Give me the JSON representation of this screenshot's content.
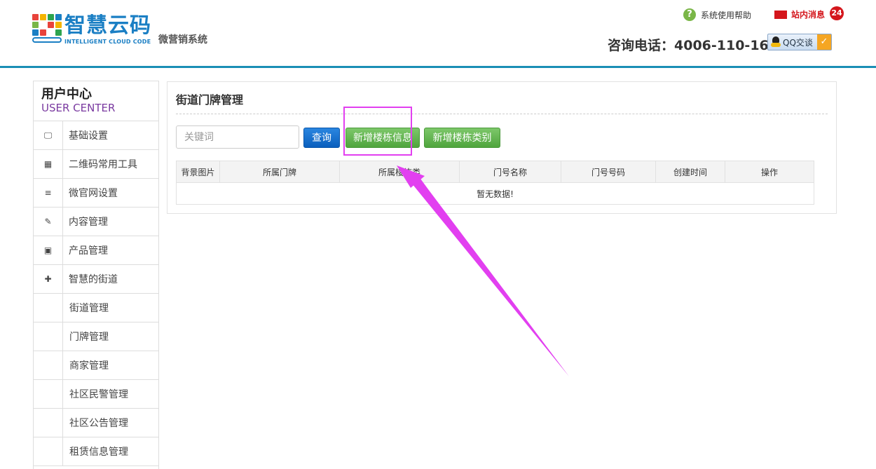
{
  "header": {
    "logo_cn": "智慧云码",
    "logo_en": "INTELLIGENT CLOUD CODE",
    "logo_sub": "微营销系统",
    "help_icon_char": "?",
    "help_label": "系统使用帮助",
    "messages_label": "站内消息",
    "messages_count": "24",
    "phone": "咨询电话：4006-110-166",
    "qq_label": "QQ交谈",
    "qq_check": "✓"
  },
  "sidebar": {
    "title_cn": "用户中心",
    "title_en": "USER CENTER",
    "items": [
      {
        "label": "基础设置",
        "icon": "monitor-icon",
        "glyph": "🖵"
      },
      {
        "label": "二维码常用工具",
        "icon": "qrcode-icon",
        "glyph": "▦"
      },
      {
        "label": "微官网设置",
        "icon": "list-icon",
        "glyph": "≡"
      },
      {
        "label": "内容管理",
        "icon": "edit-icon",
        "glyph": "✎"
      },
      {
        "label": "产品管理",
        "icon": "image-icon",
        "glyph": "▣"
      },
      {
        "label": "智慧的街道",
        "icon": "puzzle-icon",
        "glyph": "✚"
      }
    ],
    "sub_items": [
      "街道管理",
      "门牌管理",
      "商家管理",
      "社区民警管理",
      "社区公告管理",
      "租赁信息管理"
    ]
  },
  "main": {
    "title": "街道门牌管理",
    "search_placeholder": "关键词",
    "query_label": "查询",
    "add_building_info_label": "新增楼栋信息",
    "add_building_category_label": "新增楼栋类别",
    "columns": [
      "背景图片",
      "所属门牌",
      "所属楼栋类",
      "门号名称",
      "门号号码",
      "创建时间",
      "操作"
    ],
    "empty_text": "暂无数据!"
  },
  "colors": {
    "accent": "#1a8fb5",
    "brand": "#1b7fc4",
    "annotation": "#e23ff0",
    "primary_button": "#0a5fbd",
    "success_button": "#4fa53d"
  }
}
